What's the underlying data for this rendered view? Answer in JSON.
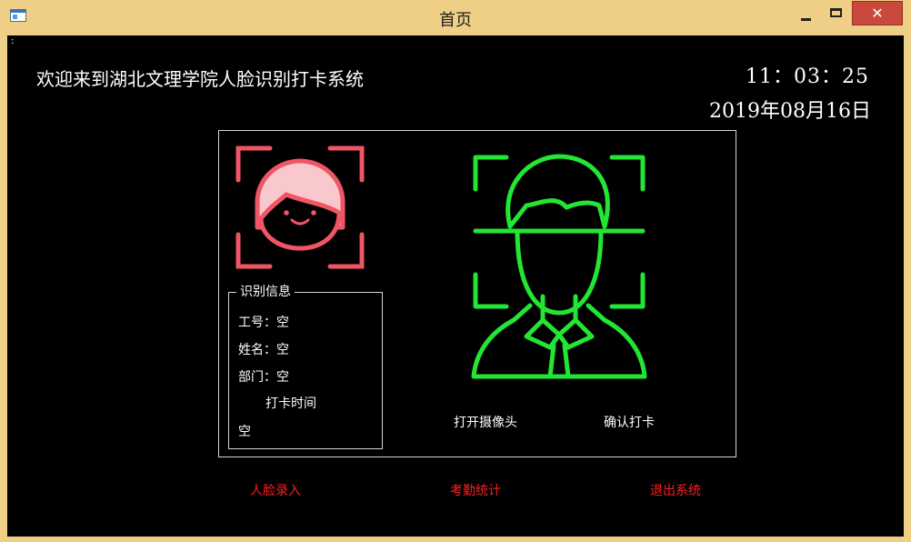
{
  "window": {
    "title": "首页",
    "close_glyph": "✕"
  },
  "header": {
    "welcome": "欢迎来到湖北文理学院人脸识别打卡系统",
    "time": "11：03：25",
    "date": "2019年08月16日"
  },
  "info": {
    "legend": "识别信息",
    "employee_id": "工号：空",
    "name": "姓名：空",
    "department": "部门：空",
    "checkin_label": "打卡时间",
    "checkin_value": "空"
  },
  "actions": {
    "open_camera": "打开摄像头",
    "confirm_checkin": "确认打卡"
  },
  "nav": {
    "face_enroll": "人脸录入",
    "attendance_stats": "考勤统计",
    "exit_system": "退出系统"
  },
  "colors": {
    "accent_red": "#f05565",
    "accent_green": "#22e633",
    "link_red": "#ff1e1e"
  },
  "icons": {
    "small": "female-face-scan-icon",
    "large": "male-face-scan-icon"
  }
}
